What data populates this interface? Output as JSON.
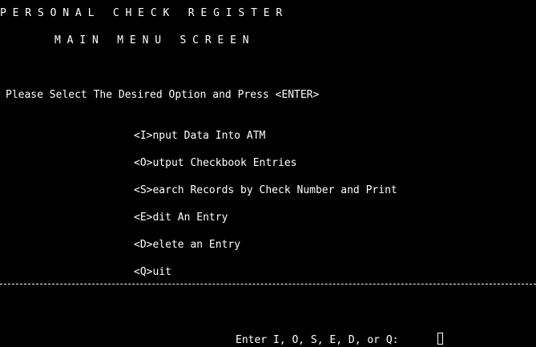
{
  "app": {
    "title": "P E R S O N A L   C H E C K   R E G I S T E R",
    "subtitle": "M A I N   M E N U   S C R E E N"
  },
  "instruction": "Please Select The Desired Option and Press <ENTER>",
  "menu": {
    "options": [
      {
        "label": "<I>nput Data Into ATM"
      },
      {
        "label": "<O>utput Checkbook Entries"
      },
      {
        "label": "<S>earch Records by Check Number and Print"
      },
      {
        "label": "<E>dit An Entry"
      },
      {
        "label": "<D>elete an Entry"
      },
      {
        "label": "<Q>uit"
      }
    ]
  },
  "prompt": {
    "label": "Enter I, O, S, E, D, or Q:"
  },
  "colors": {
    "background": "#000000",
    "foreground": "#ffffff"
  }
}
